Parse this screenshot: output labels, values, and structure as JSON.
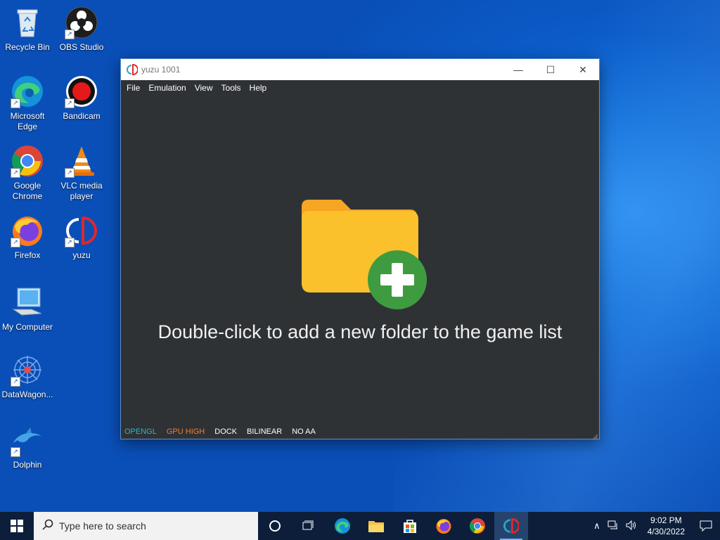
{
  "desktop": {
    "icons": [
      {
        "label": "Recycle Bin"
      },
      {
        "label": "OBS Studio"
      },
      {
        "label": "Microsoft Edge"
      },
      {
        "label": "Bandicam"
      },
      {
        "label": "Google Chrome"
      },
      {
        "label": "VLC media player"
      },
      {
        "label": "Firefox"
      },
      {
        "label": "yuzu"
      },
      {
        "label": "My Computer"
      },
      {
        "label": "DataWagon..."
      },
      {
        "label": "Dolphin"
      }
    ]
  },
  "window": {
    "title": "yuzu 1001",
    "menu": [
      "File",
      "Emulation",
      "View",
      "Tools",
      "Help"
    ],
    "hint": "Double-click to add a new folder to the game list",
    "status": [
      {
        "text": "OPENGL",
        "color": "#29b6c6"
      },
      {
        "text": "GPU HIGH",
        "color": "#f07d35"
      },
      {
        "text": "DOCK",
        "color": "#ffffff"
      },
      {
        "text": "BILINEAR",
        "color": "#ffffff"
      },
      {
        "text": "NO AA",
        "color": "#ffffff"
      }
    ],
    "controls": {
      "minimize": "—",
      "maximize": "☐",
      "close": "✕"
    }
  },
  "taskbar": {
    "search_placeholder": "Type here to search",
    "apps": [
      "task-view",
      "edge",
      "file-explorer",
      "store",
      "firefox",
      "chrome",
      "yuzu"
    ],
    "clock": {
      "time": "9:02 PM",
      "date": "4/30/2022"
    }
  },
  "colors": {
    "window_bg": "#2f3235",
    "folder_yellow": "#fbc12c",
    "plus_green": "#3f9b3f",
    "taskbar_bg": "#0c1e3a"
  }
}
